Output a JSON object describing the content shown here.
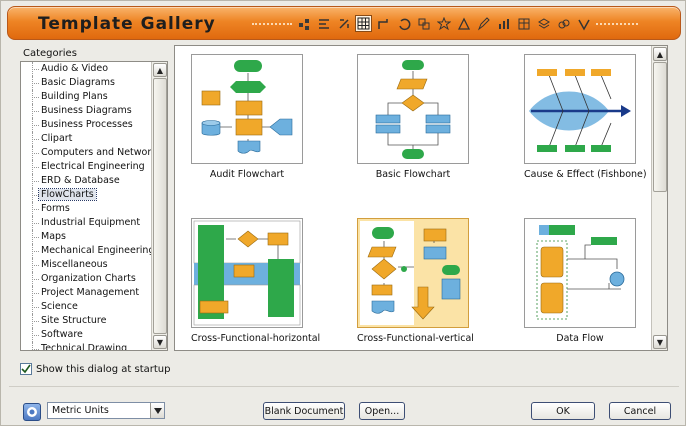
{
  "window": {
    "title": "Template Gallery"
  },
  "toolbar": {
    "icons": [
      "pointer-icon",
      "align-icon",
      "scale-icon",
      "grid-icon",
      "connector-icon",
      "rotate-icon",
      "group-icon",
      "star-icon",
      "shape-icon",
      "pen-icon",
      "chart-icon",
      "table-icon",
      "layer-icon",
      "link-icon",
      "text-icon"
    ],
    "active_index": 3
  },
  "categories": {
    "label": "Categories",
    "items": [
      "Audio & Video",
      "Basic Diagrams",
      "Building Plans",
      "Business Diagrams",
      "Business Processes",
      "Clipart",
      "Computers and Network",
      "Electrical Engineering",
      "ERD & Database",
      "FlowCharts",
      "Forms",
      "Industrial Equipment",
      "Maps",
      "Mechanical Engineering",
      "Miscellaneous",
      "Organization Charts",
      "Project Management",
      "Science",
      "Site Structure",
      "Software",
      "Technical Drawing"
    ],
    "selected": "FlowCharts"
  },
  "templates": [
    {
      "name": "Audit Flowchart"
    },
    {
      "name": "Basic Flowchart"
    },
    {
      "name": "Cause & Effect (Fishbone)"
    },
    {
      "name": "Cross-Functional-horizontal"
    },
    {
      "name": "Cross-Functional-vertical"
    },
    {
      "name": "Data Flow"
    }
  ],
  "startup": {
    "label": "Show this dialog at startup",
    "checked": true
  },
  "units": {
    "selected": "Metric Units"
  },
  "buttons": {
    "blank": "Blank Document",
    "open": "Open...",
    "ok": "OK",
    "cancel": "Cancel"
  },
  "colors": {
    "title_bar": "#ee8424",
    "flow_green": "#2ea84a",
    "flow_orange": "#f0a82a",
    "flow_blue": "#6db0de",
    "selection_highlight": "#fbe3a6"
  }
}
